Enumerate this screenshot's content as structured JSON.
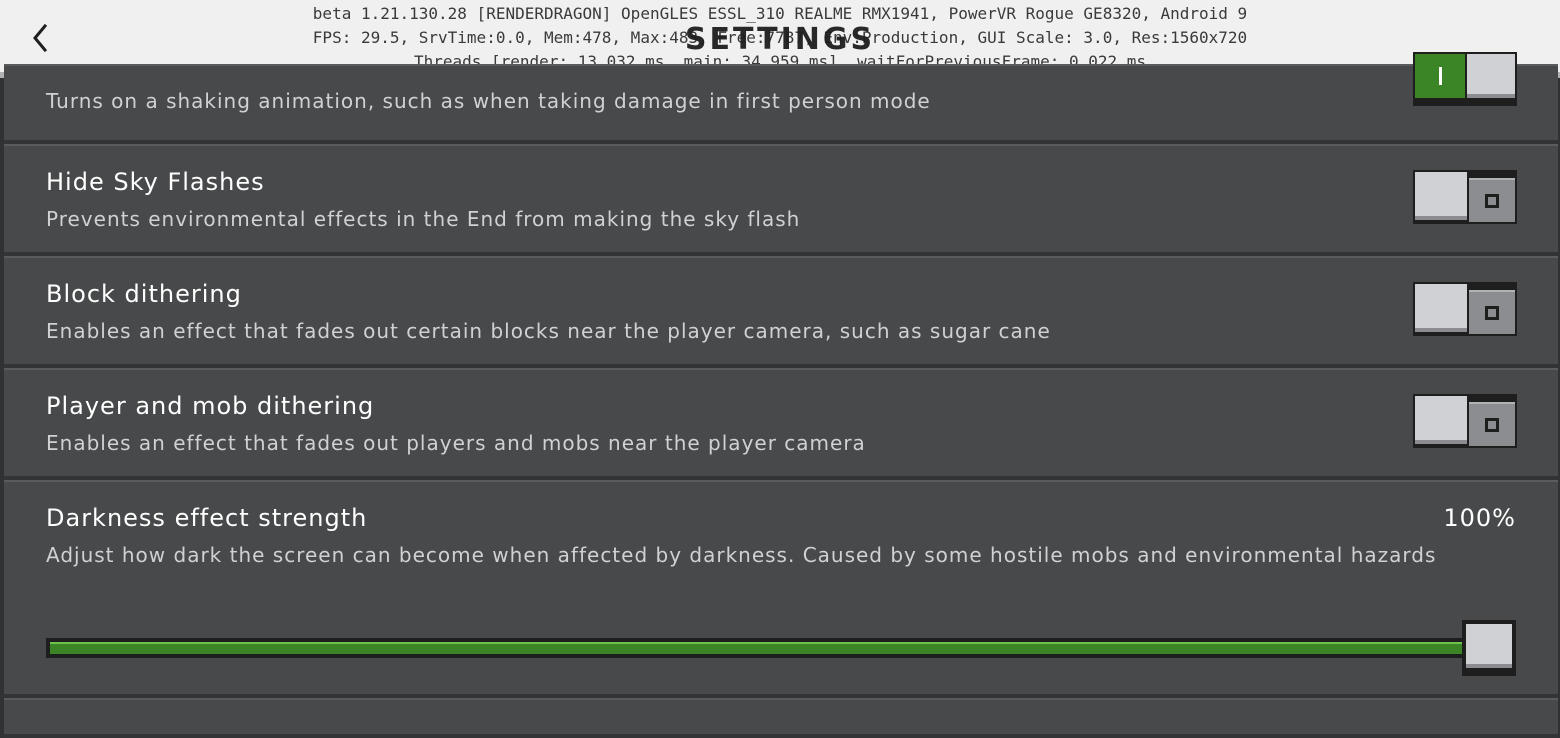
{
  "header": {
    "title": "SETTINGS",
    "debug_lines": [
      "beta 1.21.130.28 [RENDERDRAGON] OpenGLES ESSL_310 REALME RMX1941, PowerVR Rogue GE8320, Android 9",
      "FPS: 29.5, SrvTime:0.0, Mem:478, Max:483, Free:7787, Env:Production, GUI Scale: 3.0, Res:1560x720",
      "Threads [render: 13.032 ms, main: 34.959 ms], waitForPreviousFrame: 0.022 ms"
    ]
  },
  "settings": [
    {
      "desc": "Turns on a shaking animation, such as when taking damage in first person mode",
      "state": "on"
    },
    {
      "title": "Hide Sky Flashes",
      "desc": "Prevents environmental effects in the End from making the sky flash",
      "state": "off"
    },
    {
      "title": "Block dithering",
      "desc": "Enables an effect that fades out certain blocks near the player camera, such as sugar cane",
      "state": "off"
    },
    {
      "title": "Player and mob dithering",
      "desc": "Enables an effect that fades out players and mobs near the player camera",
      "state": "off"
    }
  ],
  "darkness": {
    "title": "Darkness effect strength",
    "value_label": "100%",
    "desc": "Adjust how dark the screen can become when affected by darkness. Caused by some hostile mobs and environmental hazards",
    "value_fraction": 1.0
  },
  "colors": {
    "toggle_on": "#3c8527",
    "slider_fill": "#3c8527",
    "background": "#48494a",
    "header": "#f0f0f0"
  },
  "icons": {
    "back": "chevron-left-icon"
  }
}
